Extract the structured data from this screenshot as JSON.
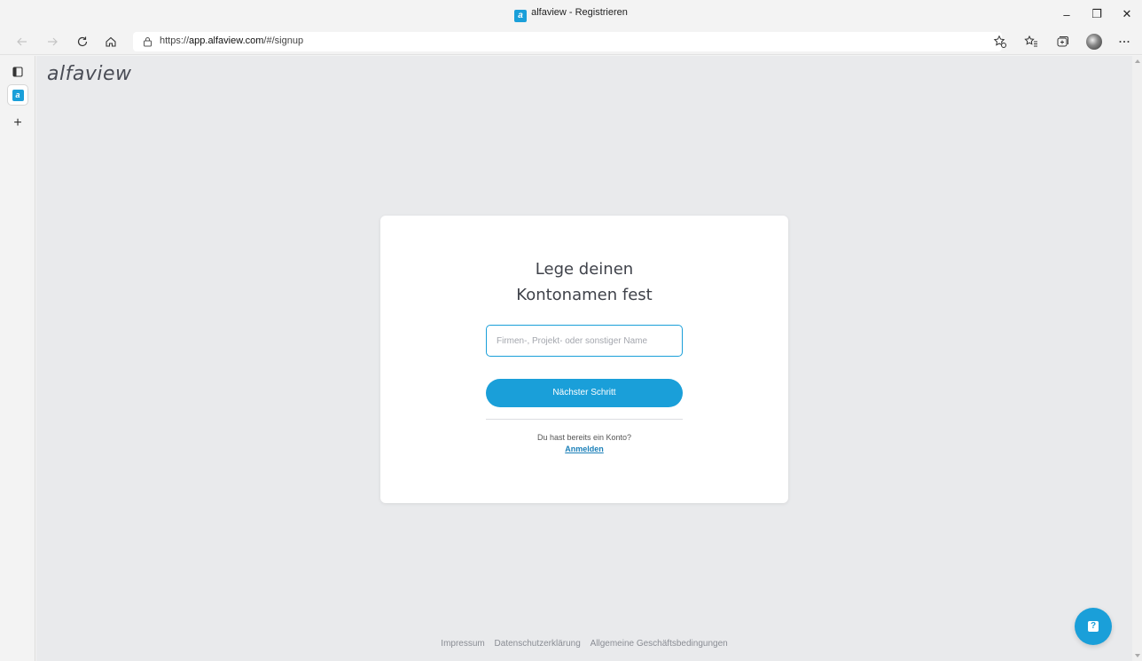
{
  "window": {
    "title": "alfaview - Registrieren",
    "favicon_letter": "a",
    "controls": {
      "minimize": "–",
      "restore": "❐",
      "close": "✕"
    }
  },
  "navbar": {
    "url_prefix": "https://",
    "url_domain": "app.alfaview.com",
    "url_path": "/#/signup",
    "icons": [
      "back-icon",
      "forward-icon",
      "refresh-icon",
      "home-icon",
      "lock-icon",
      "favorite-add-icon",
      "favorites-icon",
      "collections-icon",
      "profile-avatar",
      "more-icon"
    ]
  },
  "sidebar": {
    "tab_favicon_letter": "a",
    "new_tab": "+"
  },
  "page": {
    "logo": "alfaview",
    "card": {
      "heading_line1": "Lege deinen",
      "heading_line2": "Kontonamen fest",
      "input_placeholder": "Firmen-, Projekt- oder sonstiger Name",
      "input_value": "",
      "next_button": "Nächster Schritt",
      "account_hint": "Du hast bereits ein Konto?",
      "login_link": "Anmelden"
    },
    "footer": {
      "links": [
        "Impressum",
        "Datenschutzerklärung",
        "Allgemeine Geschäftsbedingungen"
      ]
    },
    "help_button_icon": "help-icon"
  },
  "colors": {
    "accent": "#1a9fd9",
    "page_bg": "#e9eaec",
    "card_bg": "#ffffff",
    "heading_text": "#3f424a",
    "footer_text": "#8a8d94"
  }
}
